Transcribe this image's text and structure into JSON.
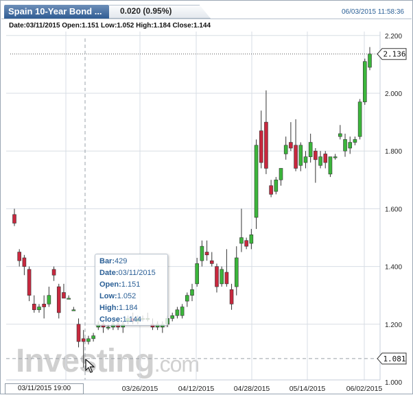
{
  "header": {
    "title": "Spain 10-Year Bond ...",
    "change": "0.020 (0.95%)",
    "timestamp": "06/03/2015 11:58:36"
  },
  "ohlc_line": "Date:03/11/2015 Open:1.151 Low:1.052 High:1.184 Close:1.144",
  "tooltip": {
    "bar_label": "Bar:",
    "bar_value": "429",
    "date_label": "Date:",
    "date_value": "03/11/2015",
    "open_label": "Open:",
    "open_value": "1.151",
    "low_label": "Low:",
    "low_value": "1.052",
    "high_label": "High:",
    "high_value": "1.184",
    "close_label": "Close:",
    "close_value": "1.144"
  },
  "crosshair_date": "03/11/2015 19:00",
  "last_price_label": "2.136",
  "crosshair_price_label": "1.081",
  "watermark": {
    "part1": "Investing",
    "part2": ".com"
  },
  "cursor_icon": "arrow-cursor-icon",
  "colors": {
    "up_candle": "#3bb53b",
    "down_candle": "#c8283e",
    "grid": "#d7dde4",
    "title_bg": "#3d6aa0",
    "blue_text": "#2a5f96"
  },
  "chart_data": {
    "type": "candlestick",
    "title": "Spain 10-Year Bond",
    "ylim": [
      1.0,
      2.2
    ],
    "y_ticks": [
      "1.000",
      "1.200",
      "1.400",
      "1.600",
      "1.800",
      "2.000",
      "2.200"
    ],
    "x_ticks": [
      "03/11/2015",
      "03/26/2015",
      "04/12/2015",
      "04/28/2015",
      "05/14/2015",
      "06/02/2015"
    ],
    "last_price": 2.136,
    "crosshair_price": 1.081,
    "grid": true,
    "candles": [
      {
        "o": 1.58,
        "h": 1.6,
        "l": 1.54,
        "c": 1.55
      },
      {
        "o": 1.45,
        "h": 1.46,
        "l": 1.4,
        "c": 1.42
      },
      {
        "o": 1.43,
        "h": 1.44,
        "l": 1.37,
        "c": 1.4
      },
      {
        "o": 1.39,
        "h": 1.4,
        "l": 1.28,
        "c": 1.3
      },
      {
        "o": 1.27,
        "h": 1.3,
        "l": 1.24,
        "c": 1.25
      },
      {
        "o": 1.25,
        "h": 1.27,
        "l": 1.24,
        "c": 1.26
      },
      {
        "o": 1.27,
        "h": 1.3,
        "l": 1.22,
        "c": 1.26
      },
      {
        "o": 1.27,
        "h": 1.33,
        "l": 1.26,
        "c": 1.3
      },
      {
        "o": 1.39,
        "h": 1.4,
        "l": 1.35,
        "c": 1.37
      },
      {
        "o": 1.33,
        "h": 1.34,
        "l": 1.22,
        "c": 1.24
      },
      {
        "o": 1.31,
        "h": 1.34,
        "l": 1.29,
        "c": 1.29
      },
      {
        "o": 1.29,
        "h": 1.3,
        "l": 1.29,
        "c": 1.29
      },
      {
        "o": 1.25,
        "h": 1.26,
        "l": 1.25,
        "c": 1.25
      },
      {
        "o": 1.2,
        "h": 1.22,
        "l": 1.12,
        "c": 1.14
      },
      {
        "o": 1.15,
        "h": 1.18,
        "l": 1.05,
        "c": 1.14
      },
      {
        "o": 1.14,
        "h": 1.16,
        "l": 1.13,
        "c": 1.15
      },
      {
        "o": 1.15,
        "h": 1.17,
        "l": 1.14,
        "c": 1.16
      },
      {
        "o": 1.19,
        "h": 1.21,
        "l": 1.18,
        "c": 1.2
      },
      {
        "o": 1.2,
        "h": 1.21,
        "l": 1.17,
        "c": 1.19
      },
      {
        "o": 1.19,
        "h": 1.2,
        "l": 1.18,
        "c": 1.19
      },
      {
        "o": 1.19,
        "h": 1.21,
        "l": 1.18,
        "c": 1.2
      },
      {
        "o": 1.2,
        "h": 1.21,
        "l": 1.18,
        "c": 1.19
      },
      {
        "o": 1.19,
        "h": 1.21,
        "l": 1.17,
        "c": 1.2
      },
      {
        "o": 1.21,
        "h": 1.23,
        "l": 1.2,
        "c": 1.22
      },
      {
        "o": 1.22,
        "h": 1.24,
        "l": 1.2,
        "c": 1.21
      },
      {
        "o": 1.21,
        "h": 1.23,
        "l": 1.2,
        "c": 1.22
      },
      {
        "o": 1.22,
        "h": 1.23,
        "l": 1.21,
        "c": 1.22
      },
      {
        "o": 1.22,
        "h": 1.24,
        "l": 1.21,
        "c": 1.22
      },
      {
        "o": 1.2,
        "h": 1.22,
        "l": 1.18,
        "c": 1.19
      },
      {
        "o": 1.19,
        "h": 1.21,
        "l": 1.18,
        "c": 1.2
      },
      {
        "o": 1.19,
        "h": 1.21,
        "l": 1.17,
        "c": 1.2
      },
      {
        "o": 1.2,
        "h": 1.23,
        "l": 1.19,
        "c": 1.22
      },
      {
        "o": 1.22,
        "h": 1.24,
        "l": 1.21,
        "c": 1.23
      },
      {
        "o": 1.23,
        "h": 1.26,
        "l": 1.22,
        "c": 1.25
      },
      {
        "o": 1.23,
        "h": 1.27,
        "l": 1.22,
        "c": 1.26
      },
      {
        "o": 1.28,
        "h": 1.31,
        "l": 1.26,
        "c": 1.3
      },
      {
        "o": 1.3,
        "h": 1.34,
        "l": 1.28,
        "c": 1.32
      },
      {
        "o": 1.34,
        "h": 1.43,
        "l": 1.33,
        "c": 1.41
      },
      {
        "o": 1.42,
        "h": 1.49,
        "l": 1.4,
        "c": 1.47
      },
      {
        "o": 1.45,
        "h": 1.49,
        "l": 1.42,
        "c": 1.44
      },
      {
        "o": 1.42,
        "h": 1.45,
        "l": 1.4,
        "c": 1.41
      },
      {
        "o": 1.4,
        "h": 1.41,
        "l": 1.31,
        "c": 1.33
      },
      {
        "o": 1.34,
        "h": 1.4,
        "l": 1.33,
        "c": 1.39
      },
      {
        "o": 1.38,
        "h": 1.46,
        "l": 1.33,
        "c": 1.34
      },
      {
        "o": 1.32,
        "h": 1.34,
        "l": 1.25,
        "c": 1.27
      },
      {
        "o": 1.33,
        "h": 1.47,
        "l": 1.3,
        "c": 1.43
      },
      {
        "o": 1.48,
        "h": 1.6,
        "l": 1.45,
        "c": 1.5
      },
      {
        "o": 1.49,
        "h": 1.5,
        "l": 1.46,
        "c": 1.47
      },
      {
        "o": 1.48,
        "h": 1.53,
        "l": 1.46,
        "c": 1.51
      },
      {
        "o": 1.57,
        "h": 1.84,
        "l": 1.53,
        "c": 1.82
      },
      {
        "o": 1.87,
        "h": 1.94,
        "l": 1.74,
        "c": 1.76
      },
      {
        "o": 1.9,
        "h": 2.01,
        "l": 1.72,
        "c": 1.74
      },
      {
        "o": 1.68,
        "h": 1.7,
        "l": 1.64,
        "c": 1.65
      },
      {
        "o": 1.66,
        "h": 1.71,
        "l": 1.65,
        "c": 1.7
      },
      {
        "o": 1.7,
        "h": 1.73,
        "l": 1.68,
        "c": 1.74
      },
      {
        "o": 1.79,
        "h": 1.85,
        "l": 1.77,
        "c": 1.82
      },
      {
        "o": 1.83,
        "h": 1.9,
        "l": 1.8,
        "c": 1.81
      },
      {
        "o": 1.82,
        "h": 1.91,
        "l": 1.73,
        "c": 1.74
      },
      {
        "o": 1.75,
        "h": 1.83,
        "l": 1.73,
        "c": 1.82
      },
      {
        "o": 1.76,
        "h": 1.8,
        "l": 1.74,
        "c": 1.78
      },
      {
        "o": 1.78,
        "h": 1.86,
        "l": 1.76,
        "c": 1.83
      },
      {
        "o": 1.8,
        "h": 1.81,
        "l": 1.69,
        "c": 1.77
      },
      {
        "o": 1.75,
        "h": 1.8,
        "l": 1.74,
        "c": 1.78
      },
      {
        "o": 1.79,
        "h": 1.8,
        "l": 1.74,
        "c": 1.76
      },
      {
        "o": 1.72,
        "h": 1.78,
        "l": 1.71,
        "c": 1.78
      },
      {
        "o": 1.78,
        "h": 1.79,
        "l": 1.77,
        "c": 1.78
      },
      {
        "o": 1.85,
        "h": 1.89,
        "l": 1.84,
        "c": 1.86
      },
      {
        "o": 1.8,
        "h": 1.86,
        "l": 1.78,
        "c": 1.84
      },
      {
        "o": 1.81,
        "h": 1.85,
        "l": 1.79,
        "c": 1.83
      },
      {
        "o": 1.83,
        "h": 1.85,
        "l": 1.82,
        "c": 1.84
      },
      {
        "o": 1.85,
        "h": 1.98,
        "l": 1.84,
        "c": 1.97
      },
      {
        "o": 1.97,
        "h": 2.12,
        "l": 1.96,
        "c": 2.11
      },
      {
        "o": 2.09,
        "h": 2.16,
        "l": 2.08,
        "c": 2.136
      }
    ]
  }
}
